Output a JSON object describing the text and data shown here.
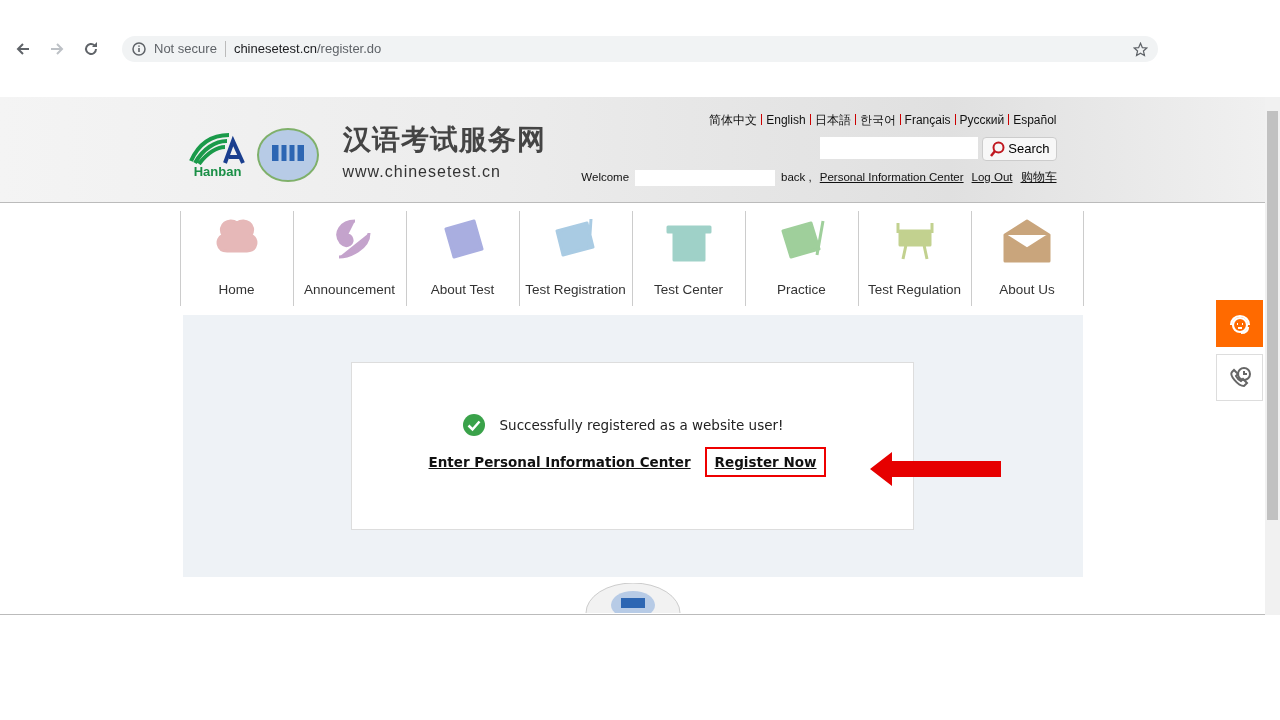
{
  "browser": {
    "security": "Not secure",
    "url_host": "chinesetest.cn",
    "url_path": "/register.do",
    "forward_disabled": true
  },
  "header": {
    "logo_text": "Hanban",
    "site_title": "汉语考试服务网",
    "site_url": "www.chinesetest.cn",
    "languages": [
      "简体中文",
      "English",
      "日本語",
      "한국어",
      "Français",
      "Русский",
      "Español"
    ],
    "search": {
      "button": "Search"
    },
    "welcome": {
      "before": "Welcome",
      "after": "back ,",
      "links": [
        "Personal Information Center",
        "Log Out",
        "购物车"
      ]
    }
  },
  "nav": [
    {
      "label": "Home",
      "color": "#e6b8b8"
    },
    {
      "label": "Announcement",
      "color": "#c4a3cc"
    },
    {
      "label": "About Test",
      "color": "#a9aee0"
    },
    {
      "label": "Test Registration",
      "color": "#a9cbe3"
    },
    {
      "label": "Test Center",
      "color": "#9fd1c8"
    },
    {
      "label": "Practice",
      "color": "#9fcf9b"
    },
    {
      "label": "Test Regulation",
      "color": "#c2d18f"
    },
    {
      "label": "About Us",
      "color": "#c9a57c"
    }
  ],
  "message": {
    "text": "Successfully registered as a website user!",
    "links": [
      {
        "label": "Enter Personal Information Center",
        "highlighted": false
      },
      {
        "label": "Register Now",
        "highlighted": true
      }
    ]
  },
  "side_buttons": [
    {
      "kind": "support"
    },
    {
      "kind": "callback"
    }
  ]
}
